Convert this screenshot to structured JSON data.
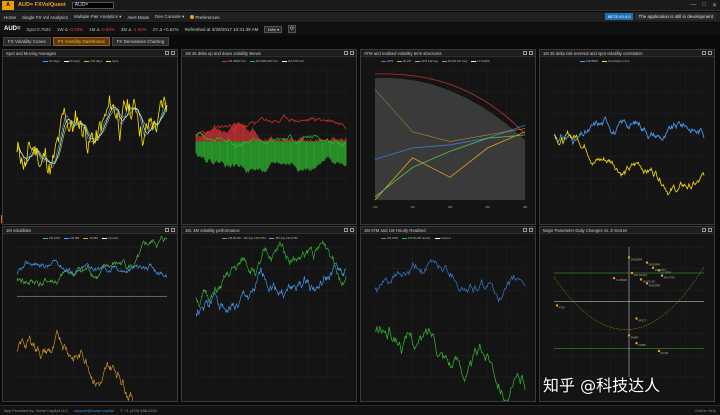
{
  "app": {
    "logo": "A",
    "title": "AUD= FXVolQuant",
    "input_value": "AUD=",
    "window_minimize": "—",
    "window_maximize": "□",
    "window_close": "✕"
  },
  "menu": {
    "items": [
      "Home",
      "Single FX Vol Analytics",
      "Multiple Pair Analytics ▾",
      "Alert Mode",
      "Dev Console ▾",
      "Preferences"
    ],
    "beta_badge": "BETA V0.9.0",
    "dev_notice": "The application is still in development"
  },
  "ticker": {
    "symbol": "AUD=",
    "spot_label": "Spot",
    "spot_value": "0.7622",
    "vol_1w_label": "1W Δ",
    "vol_1w_value": "-0.03%",
    "vol_1m_label": "1M Δ",
    "vol_1m_value": "-0.60%",
    "vol_3m_label": "3M Δ",
    "vol_3m_value": "-1.50%",
    "vol_2y_label": "2Y Δ",
    "vol_2y_value": "+0.62%",
    "refreshed": "Refreshed at 3/28/2017 10:31:39 AM",
    "interval_select": "1Min ▾",
    "refresh_icon": "⟳"
  },
  "tabs": [
    "FX Volatility Cones",
    "FX Volatility Dashboard",
    "FX Derivatives Charting"
  ],
  "panels": [
    {
      "title": "Spot and Moving Averages",
      "legend": [
        "20 days",
        "50 days",
        "100 days",
        "Spot"
      ],
      "legend_colors": [
        "#4aa3ff",
        "#ffffff",
        "#9ad04a",
        "#ffe000"
      ]
    },
    {
      "title": "1M 25 delta up and down volatility skews",
      "legend": [
        "1M 25RR Vol",
        "1M 25DCRR Vol",
        "1M ATM Vol"
      ],
      "legend_colors": [
        "#e03030",
        "#30c030",
        "#ffffff"
      ]
    },
    {
      "title": "ATM and realised volatility term structures",
      "legend": [
        "ATM",
        "RLZD",
        "ATM 1W avg",
        "RLZD 1W avg",
        "1Y-VolRS"
      ],
      "legend_colors": [
        "#3a7ad0",
        "#e0a020",
        "#aaaaaa",
        "#50c050",
        "#ffffff"
      ]
    },
    {
      "title": "1M 25 delta risk reversal and spot volatility correlation",
      "legend": [
        "1M25RR",
        "Correlation (1m)"
      ],
      "legend_colors": [
        "#4aa3ff",
        "#ffe000"
      ]
    },
    {
      "title": "1M volatilities",
      "legend": [
        "1M ATM",
        "1M RR",
        "1M BF",
        "Current"
      ],
      "legend_colors": [
        "#50c050",
        "#4aa3ff",
        "#e0a020",
        "#ffffff"
      ]
    },
    {
      "title": "1M, 3M volatility performance",
      "legend": [
        "1M RLZD - 1M avg 1W ATM",
        "3M avg 1W ATM"
      ],
      "legend_colors": [
        "#30c030",
        "#4aa3ff"
      ]
    },
    {
      "title": "1M ATM and 1W Hourly Realized",
      "legend": [
        "1M ATM",
        "1W RLZD Hourly",
        "Current"
      ],
      "legend_colors": [
        "#3a7ad0",
        "#30c030",
        "#ffffff"
      ]
    },
    {
      "title": "Major Parameter Daily Changes vs. Z-Scores",
      "legend": [],
      "legend_colors": []
    }
  ],
  "scatter_labels": [
    "1M25RR",
    "3M25RR",
    "1M ATM",
    "1Y ATM",
    "3M ATM",
    "2W RLZD",
    "1M RLZD",
    "3M25RR",
    "1Y25RR",
    "SPOT",
    "3MBF",
    "1WBF",
    "ATM",
    "RLZD"
  ],
  "footer": {
    "provider": "App Provided by: Xome Capital LLC",
    "email": "support@xome.capital",
    "phone": "T: +1 (223) 456-0221",
    "help": "Online Help"
  },
  "watermark": "知乎 @科技达人",
  "colors": {
    "accent": "#f0a020",
    "positive": "#30c030",
    "negative": "#e03030",
    "blue": "#4aa3ff",
    "yellow": "#ffe000"
  }
}
